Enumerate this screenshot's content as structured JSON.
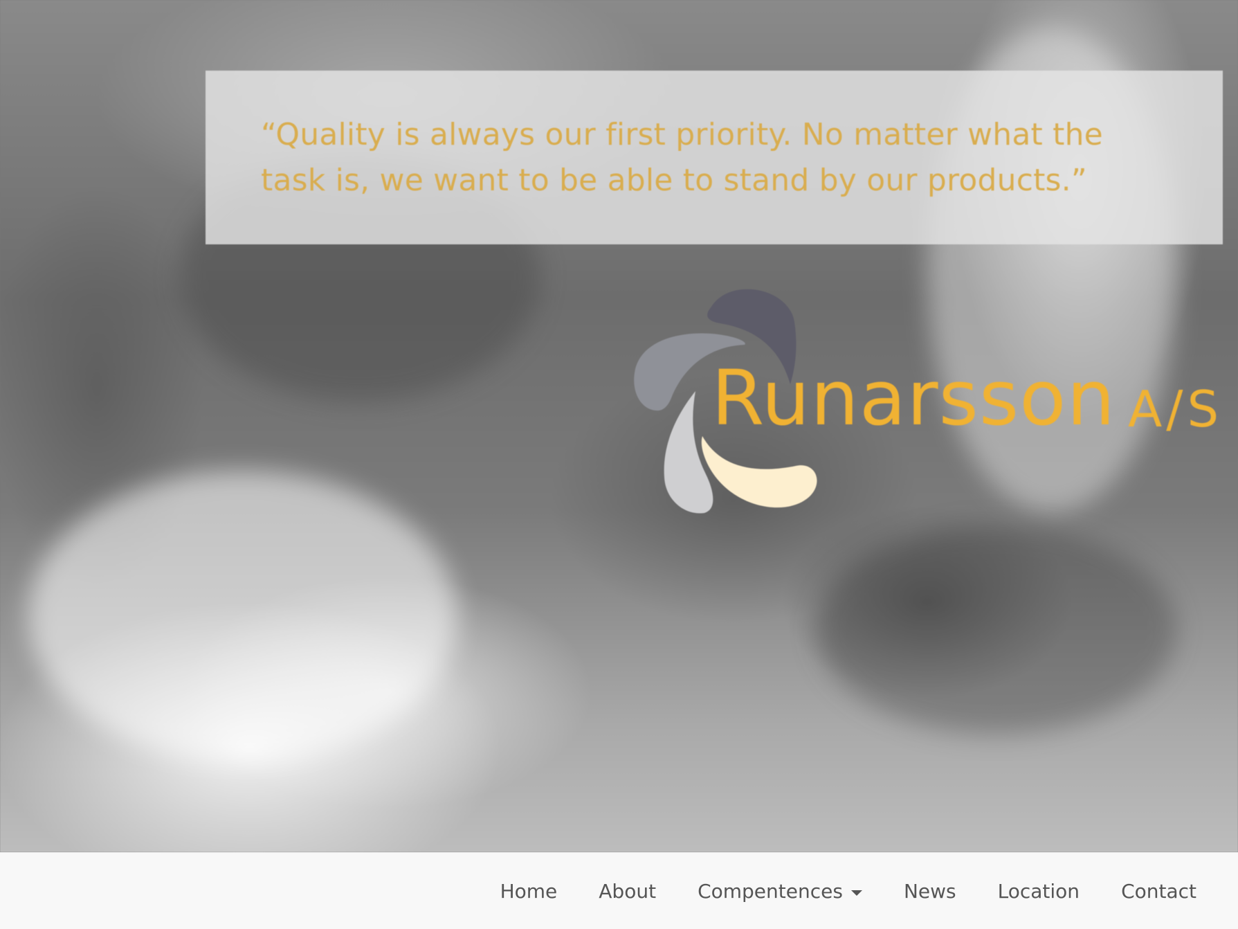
{
  "hero": {
    "quote": "“Quality is always our first priority. No matter what the task is, we want to be able to stand by our products.”"
  },
  "logo": {
    "name": "Runarsson",
    "suffix": "A/S",
    "colors": {
      "text": "#f0b233",
      "petal_dark": "#5d5c69",
      "petal_mid": "#8f9198",
      "petal_light": "#cfcfd1",
      "petal_cream": "#fdefcf"
    }
  },
  "nav": {
    "items": [
      {
        "label": "Home"
      },
      {
        "label": "About"
      },
      {
        "label": "Compentences",
        "dropdown": true
      },
      {
        "label": "News"
      },
      {
        "label": "Location"
      },
      {
        "label": "Contact"
      }
    ]
  },
  "colors": {
    "quote_text": "#d9ad4f",
    "nav_background": "#f8f8f8",
    "nav_text": "#555555"
  }
}
